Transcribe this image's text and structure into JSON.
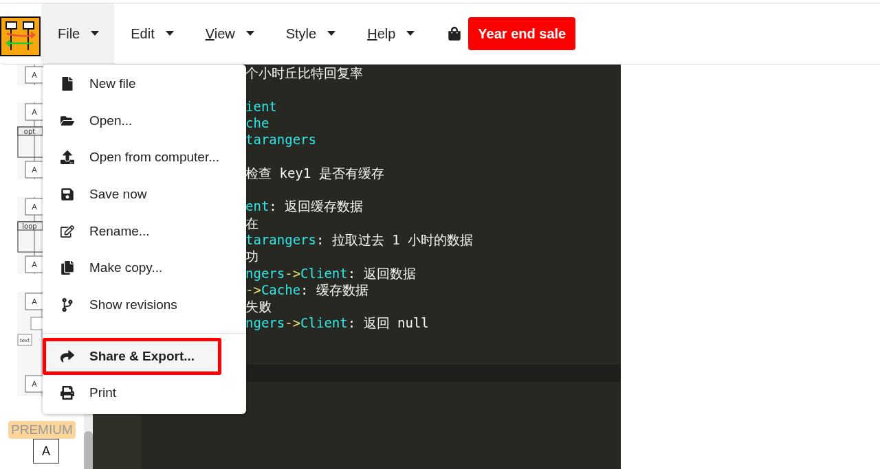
{
  "menubar": {
    "menus": [
      {
        "label": "File",
        "open": true,
        "underlined_first": false
      },
      {
        "label": "Edit",
        "open": false,
        "underlined_first": false
      },
      {
        "label": "View",
        "open": false,
        "underlined_first": true
      },
      {
        "label": "Style",
        "open": false,
        "underlined_first": false
      },
      {
        "label": "Help",
        "open": false,
        "underlined_first": true
      }
    ],
    "sale_button": "Year end sale"
  },
  "file_menu": {
    "items": [
      {
        "label": "New file",
        "highlighted": false
      },
      {
        "label": "Open...",
        "highlighted": false
      },
      {
        "label": "Open from computer...",
        "highlighted": false
      },
      {
        "label": "Save now",
        "highlighted": false
      },
      {
        "label": "Rename...",
        "highlighted": false
      },
      {
        "label": "Make copy...",
        "highlighted": false
      },
      {
        "label": "Show revisions",
        "highlighted": false
      },
      {
        "label": "Share & Export...",
        "highlighted": true
      },
      {
        "label": "Print",
        "highlighted": false
      }
    ]
  },
  "sidebar": {
    "thumbnails": [
      {
        "kind": "single",
        "labels": [
          "A"
        ]
      },
      {
        "kind": "fragment",
        "labels": [
          "A",
          "opt",
          "A"
        ]
      },
      {
        "kind": "fragment",
        "labels": [
          "A",
          "loop",
          "A"
        ]
      },
      {
        "kind": "activation",
        "labels": [
          "A",
          "text",
          "A"
        ]
      }
    ],
    "premium_badge": "PREMIUM",
    "last_shape": "A"
  },
  "editor": {
    "lines": [
      {
        "kind": "code",
        "segments": [
          {
            "kind": "text",
            "text": "个小时丘比特回复率"
          }
        ]
      },
      {
        "kind": "blank"
      },
      {
        "kind": "code",
        "segments": [
          {
            "kind": "name",
            "text": "ient"
          }
        ]
      },
      {
        "kind": "code",
        "segments": [
          {
            "kind": "name",
            "text": "che"
          }
        ]
      },
      {
        "kind": "code",
        "segments": [
          {
            "kind": "name",
            "text": "tarangers"
          }
        ]
      },
      {
        "kind": "blank"
      },
      {
        "kind": "code",
        "segments": [
          {
            "kind": "text",
            "text": "检查 key1 是否有缓存"
          }
        ]
      },
      {
        "kind": "blank"
      },
      {
        "kind": "code",
        "segments": [
          {
            "kind": "name",
            "text": "ent"
          },
          {
            "kind": "text",
            "text": ": 返回缓存数据"
          }
        ]
      },
      {
        "kind": "code",
        "segments": [
          {
            "kind": "text",
            "text": "在"
          }
        ]
      },
      {
        "kind": "code",
        "segments": [
          {
            "kind": "name",
            "text": "tarangers"
          },
          {
            "kind": "text",
            "text": ": 拉取过去 1 小时的数据"
          }
        ]
      },
      {
        "kind": "code",
        "segments": [
          {
            "kind": "text",
            "text": "功"
          }
        ]
      },
      {
        "kind": "code",
        "segments": [
          {
            "kind": "name",
            "text": "ngers"
          },
          {
            "kind": "arrow",
            "text": "->"
          },
          {
            "kind": "name",
            "text": "Client"
          },
          {
            "kind": "text",
            "text": ": 返回数据"
          }
        ]
      },
      {
        "kind": "code",
        "segments": [
          {
            "kind": "arrow",
            "text": "->"
          },
          {
            "kind": "name",
            "text": "Cache"
          },
          {
            "kind": "text",
            "text": ": 缓存数据"
          }
        ]
      },
      {
        "kind": "code",
        "segments": [
          {
            "kind": "text",
            "text": "失败"
          }
        ]
      },
      {
        "kind": "code",
        "segments": [
          {
            "kind": "name",
            "text": "ngers"
          },
          {
            "kind": "arrow",
            "text": "->"
          },
          {
            "kind": "name",
            "text": "Client"
          },
          {
            "kind": "text",
            "text": ": 返回 null"
          }
        ]
      },
      {
        "kind": "blank"
      },
      {
        "kind": "blank"
      },
      {
        "kind": "cursor"
      }
    ]
  }
}
